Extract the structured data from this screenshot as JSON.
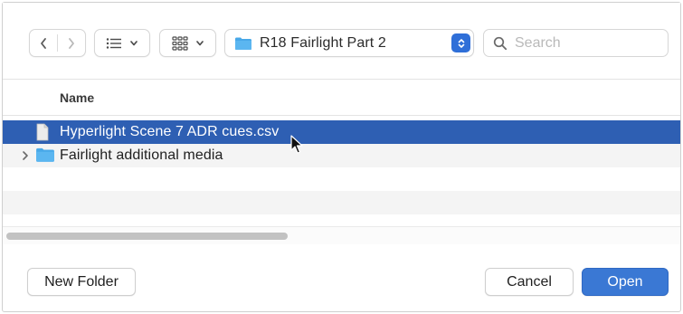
{
  "toolbar": {
    "back_icon": "chevron-left-icon",
    "forward_icon": "chevron-right-icon",
    "list_view_icon": "list-view-icon",
    "grid_view_icon": "grid-view-icon",
    "location": {
      "label": "R18 Fairlight Part 2",
      "icon": "folder-icon"
    },
    "search": {
      "placeholder": "Search",
      "value": ""
    }
  },
  "list": {
    "column_header": "Name",
    "rows": [
      {
        "label": "Hyperlight Scene 7 ADR cues.csv",
        "type": "file",
        "selected": true
      },
      {
        "label": "Fairlight additional media",
        "type": "folder",
        "selected": false
      }
    ]
  },
  "footer": {
    "new_folder_label": "New Folder",
    "cancel_label": "Cancel",
    "open_label": "Open"
  },
  "colors": {
    "accent": "#2e5fb3",
    "open_button": "#3a78d4",
    "folder": "#48a8e8"
  }
}
